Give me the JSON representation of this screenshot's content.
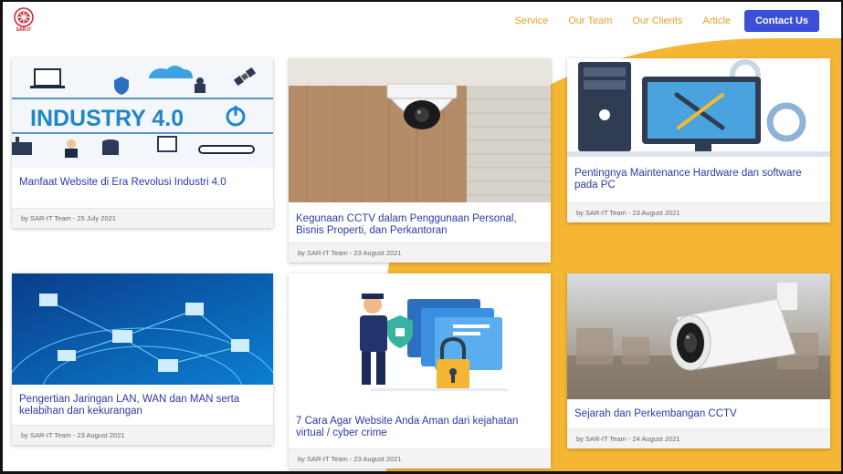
{
  "nav": {
    "logo_text": "SAR-IT",
    "links": [
      "Service",
      "Our Team",
      "Our Clients",
      "Article"
    ],
    "contact_label": "Contact Us"
  },
  "colors": {
    "accent": "#e4a12b",
    "primary": "#3b4fd9",
    "title": "#2d3aa5",
    "background_shape": "#f5b733"
  },
  "articles": [
    {
      "title": "Manfaat Website di Era Revolusi Industri 4.0",
      "meta": "by SAR-IT Team - 25 July 2021",
      "image_text": "INDUSTRY 4.0",
      "icon": "industry-4-illustration"
    },
    {
      "title": "Kegunaan CCTV dalam Penggunaan Personal, Bisnis Properti, dan Perkantoran",
      "meta": "by SAR-IT Team - 23 August 2021",
      "icon": "dome-cctv-photo"
    },
    {
      "title": "Pentingnya Maintenance Hardware dan software pada PC",
      "meta": "by SAR-IT Team - 23 August 2021",
      "icon": "pc-maintenance-illustration"
    },
    {
      "title": "Pengertian Jaringan LAN, WAN dan MAN serta kelabihan dan kekurangan",
      "meta": "by SAR-IT Team - 23 August 2021",
      "icon": "network-globe-photo"
    },
    {
      "title": "7 Cara Agar Website Anda Aman dari kejahatan virtual / cyber crime",
      "meta": "by SAR-IT Team - 23 August 2021",
      "icon": "security-guard-illustration"
    },
    {
      "title": "Sejarah dan Perkembangan CCTV",
      "meta": "by SAR-IT Team - 24 August 2021",
      "icon": "bullet-cctv-photo"
    }
  ]
}
